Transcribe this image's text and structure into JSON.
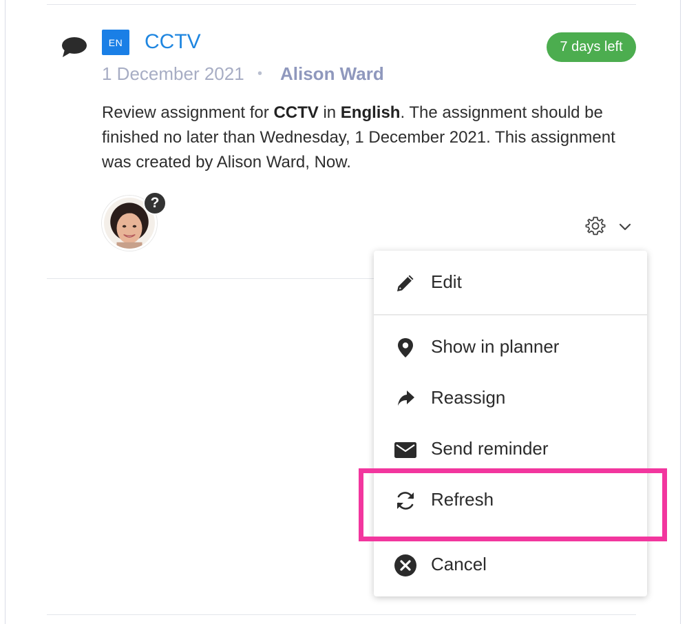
{
  "assignment": {
    "language_badge": "EN",
    "title": "CCTV",
    "days_left": "7 days left",
    "date": "1 December 2021",
    "separator": "•",
    "author": "Alison Ward",
    "description": {
      "part1": "Review assignment for ",
      "subject": "CCTV",
      "part2": " in ",
      "language": "English",
      "part3": ". The assignment should be finished no later than Wednesday, 1 December 2021. This assignment was created by Alison Ward, Now."
    },
    "help_badge": "?"
  },
  "colors": {
    "accent": "#1f86e0",
    "badge_green": "#4cad4f",
    "highlight": "#f2369e"
  },
  "menu": {
    "items": [
      {
        "label": "Edit",
        "icon": "pencil-icon"
      },
      {
        "label": "Show in planner",
        "icon": "location-pin-icon"
      },
      {
        "label": "Reassign",
        "icon": "share-arrow-icon"
      },
      {
        "label": "Send reminder",
        "icon": "envelope-icon"
      },
      {
        "label": "Refresh",
        "icon": "refresh-icon"
      },
      {
        "label": "Cancel",
        "icon": "cancel-circle-icon"
      }
    ]
  }
}
